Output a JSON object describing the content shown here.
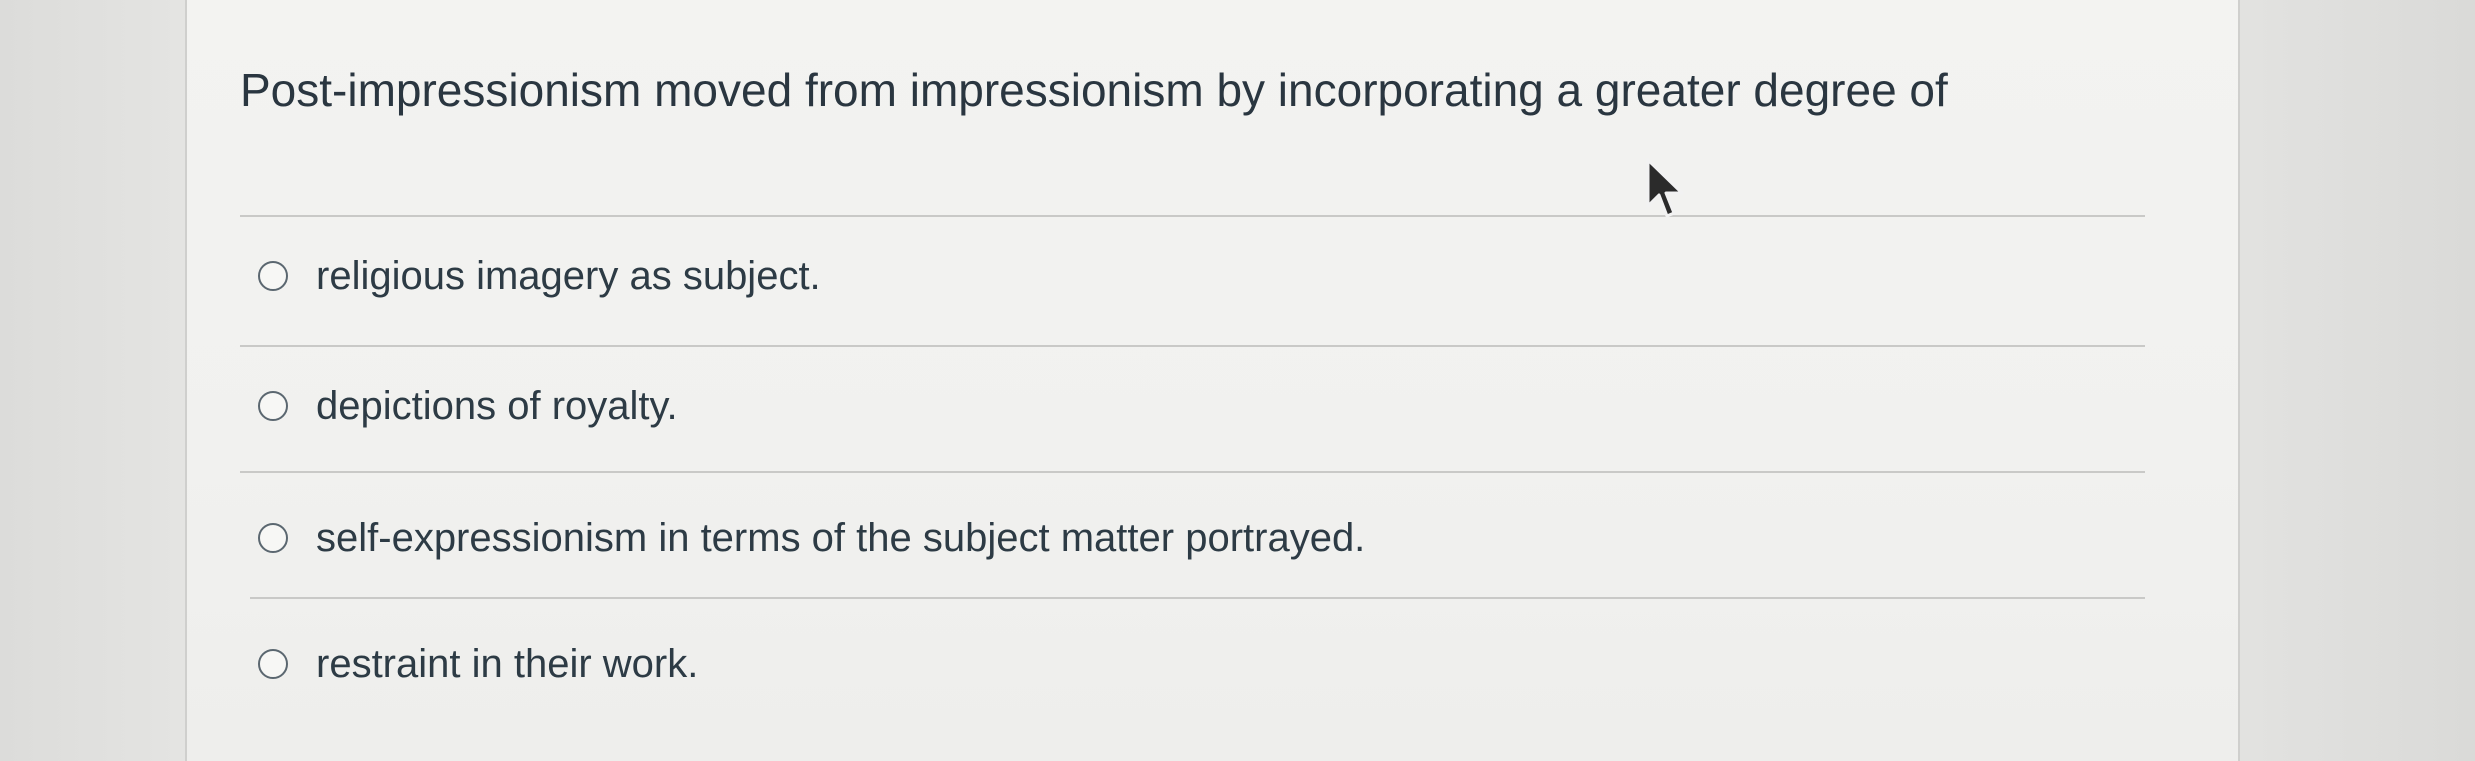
{
  "question": {
    "text": "Post-impressionism moved from impressionism by incorporating a greater degree of"
  },
  "answers": [
    {
      "label": "religious imagery as subject."
    },
    {
      "label": "depictions of royalty."
    },
    {
      "label": "self-expressionism in terms of the subject matter portrayed."
    },
    {
      "label": "restraint in their work."
    }
  ],
  "icons": {
    "radio": "radio-unselected-icon",
    "cursor": "mouse-pointer-icon"
  },
  "colors": {
    "text": "#2d3b45",
    "divider": "#c9c9c7",
    "background": "#f1f1ef"
  }
}
